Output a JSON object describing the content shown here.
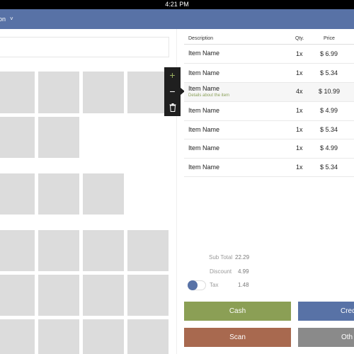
{
  "status": {
    "time": "4:21 PM"
  },
  "appbar": {
    "title": "on",
    "caret": "˅"
  },
  "popup": {
    "add": "+",
    "remove": "−",
    "delete": "🗑"
  },
  "order": {
    "columns": {
      "description": "Description",
      "qty": "Qty.",
      "price": "Price"
    },
    "items": [
      {
        "name": "Item Name",
        "detail": "",
        "qty": "1x",
        "price": "$ 6.99"
      },
      {
        "name": "Item Name",
        "detail": "",
        "qty": "1x",
        "price": "$ 5.34"
      },
      {
        "name": "Item Name",
        "detail": "Details about the item",
        "qty": "4x",
        "price": "$ 10.99"
      },
      {
        "name": "Item Name",
        "detail": "",
        "qty": "1x",
        "price": "$ 4.99"
      },
      {
        "name": "Item Name",
        "detail": "",
        "qty": "1x",
        "price": "$ 5.34"
      },
      {
        "name": "Item Name",
        "detail": "",
        "qty": "1x",
        "price": "$ 4.99"
      },
      {
        "name": "Item Name",
        "detail": "",
        "qty": "1x",
        "price": "$ 5.34"
      }
    ]
  },
  "summary": {
    "subtotal_label": "Sub Total",
    "subtotal_value": "22.29",
    "discount_label": "Discount",
    "discount_value": "4.99",
    "tax_label": "Tax",
    "tax_value": "1.48"
  },
  "buttons": {
    "cash": "Cash",
    "credit": "Cred",
    "scan": "Scan",
    "other": "Oth"
  },
  "colors": {
    "appbar": "#5872a6",
    "cash": "#8b9f55",
    "credit": "#5872a6",
    "scan": "#a8694f",
    "other": "#8a8a8a",
    "detail": "#8aa05a"
  }
}
